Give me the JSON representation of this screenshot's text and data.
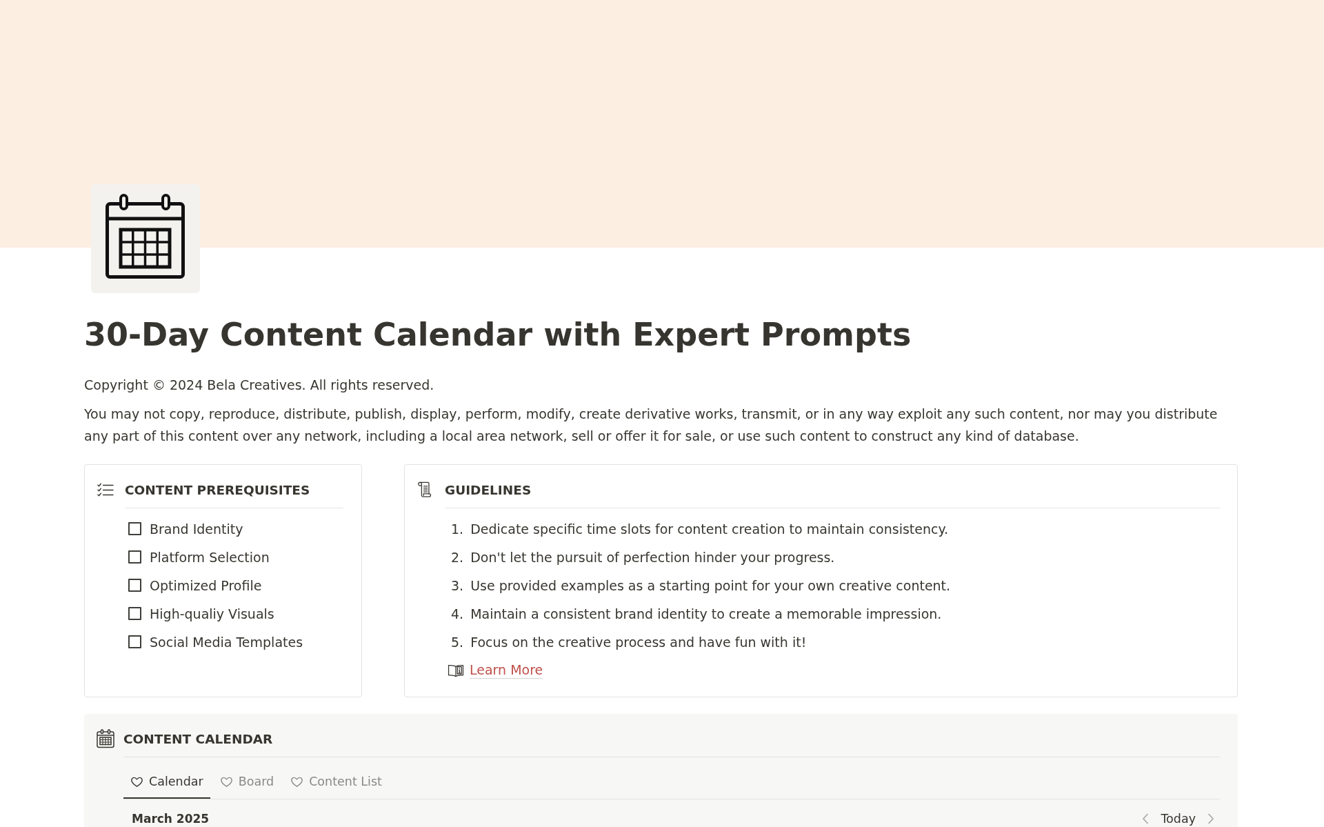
{
  "page": {
    "title": "30-Day Content Calendar with Expert Prompts",
    "copyright": "Copyright © 2024 Bela Creatives. All rights reserved.",
    "notice": "You may not copy, reproduce, distribute, publish, display, perform, modify, create derivative works, transmit, or in any way exploit any such content, nor may you distribute any part of this content over any network, including a local area network, sell or offer it for sale, or use such content to construct any kind of database."
  },
  "prerequisites": {
    "title": "CONTENT PREREQUISITES",
    "items": [
      {
        "label": "Brand Identity",
        "checked": false
      },
      {
        "label": "Platform Selection",
        "checked": false
      },
      {
        "label": "Optimized Profile",
        "checked": false
      },
      {
        "label": "High-qualiy Visuals",
        "checked": false
      },
      {
        "label": "Social Media Templates",
        "checked": false
      }
    ]
  },
  "guidelines": {
    "title": "GUIDELINES",
    "items": [
      {
        "number": "1.",
        "text": "Dedicate specific time slots for content creation to maintain consistency."
      },
      {
        "number": "2.",
        "text": "Don't let the pursuit of perfection hinder your progress."
      },
      {
        "number": "3.",
        "text": "Use provided examples as a starting point for your own creative content."
      },
      {
        "number": "4.",
        "text": "Maintain a consistent brand identity to create a memorable impression."
      },
      {
        "number": "5.",
        "text": "Focus on the creative process and have fun with it!"
      }
    ],
    "link": "Learn More"
  },
  "content_calendar": {
    "title": "CONTENT CALENDAR",
    "tabs": [
      {
        "label": "Calendar",
        "selected": true
      },
      {
        "label": "Board",
        "selected": false
      },
      {
        "label": "Content List",
        "selected": false
      }
    ],
    "month": "March 2025",
    "today_button": "Today"
  }
}
